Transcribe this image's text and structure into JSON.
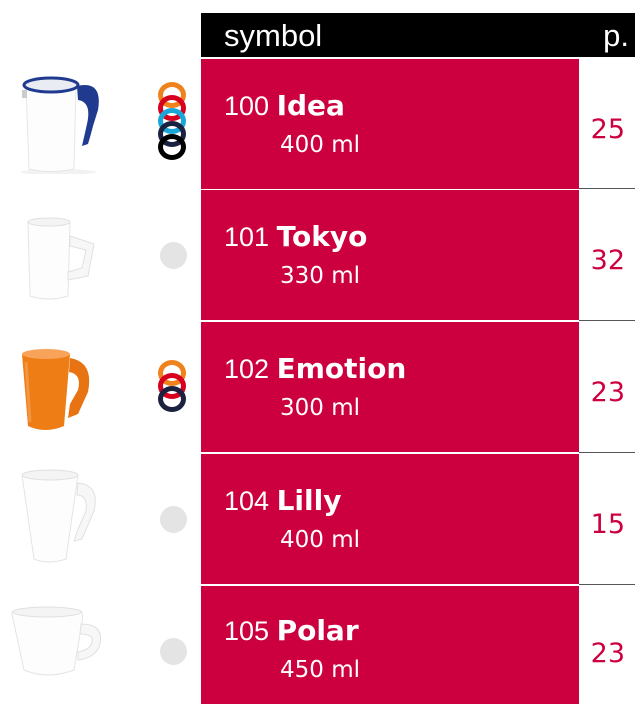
{
  "header": {
    "symbol_label": "symbol",
    "page_label": "p."
  },
  "colors": {
    "accent_red": "#cc003f",
    "header_black": "#000000",
    "swatch_grey": "#e4e4e4"
  },
  "rows": [
    {
      "code": "100",
      "name": "Idea",
      "volume": "400 ml",
      "page": "25",
      "mug_icon": "jug-icon",
      "swatches": [
        "#f0821e",
        "#d7001e",
        "#19a7d8",
        "#1a2240",
        "#000000"
      ]
    },
    {
      "code": "101",
      "name": "Tokyo",
      "volume": "330 ml",
      "page": "32",
      "mug_icon": "mug-icon",
      "swatches": []
    },
    {
      "code": "102",
      "name": "Emotion",
      "volume": "300 ml",
      "page": "23",
      "mug_icon": "mug-icon",
      "swatches": [
        "#f0821e",
        "#d7001e",
        "#1a2240"
      ]
    },
    {
      "code": "104",
      "name": "Lilly",
      "volume": "400 ml",
      "page": "15",
      "mug_icon": "mug-icon",
      "swatches": []
    },
    {
      "code": "105",
      "name": "Polar",
      "volume": "450 ml",
      "page": "23",
      "mug_icon": "mug-icon",
      "swatches": []
    }
  ]
}
